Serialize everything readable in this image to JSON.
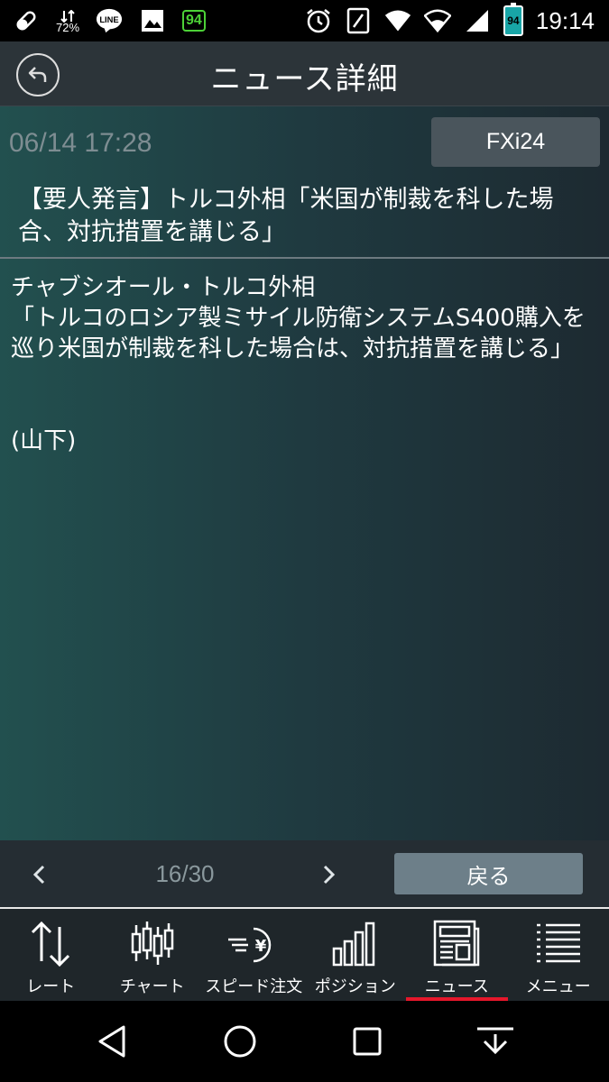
{
  "status_bar": {
    "battery_small": "72%",
    "line_label": "LINE",
    "notif_badge": "94",
    "battery_level": "94",
    "time": "19:14",
    "icons": [
      "pill-icon",
      "data-speed-icon",
      "line-app-icon",
      "gallery-icon",
      "battery-app-icon",
      "alarm-icon",
      "nfc-icon",
      "wifi-call-icon",
      "wifi-icon",
      "signal-icon",
      "battery-icon"
    ]
  },
  "header": {
    "title": "ニュース詳細",
    "back_icon": "reply-arrow-icon"
  },
  "article": {
    "datetime": "06/14 17:28",
    "source": "FXi24",
    "headline": "【要人発言】トルコ外相「米国が制裁を科した場合、対抗措置を講じる」",
    "body": "チャブシオール・トルコ外相\n「トルコのロシア製ミサイル防衛システムS400購入を巡り米国が制裁を科した場合は、対抗措置を講じる」\n\n\n(山下)"
  },
  "pager": {
    "current": "16/30",
    "return_label": "戻る"
  },
  "tabs": [
    {
      "label": "レート",
      "icon": "rate-arrows-icon",
      "active": false
    },
    {
      "label": "チャート",
      "icon": "candlestick-icon",
      "active": false
    },
    {
      "label": "スピード注文",
      "icon": "speed-yen-icon",
      "active": false
    },
    {
      "label": "ポジション",
      "icon": "bar-chart-icon",
      "active": false
    },
    {
      "label": "ニュース",
      "icon": "newspaper-icon",
      "active": true
    },
    {
      "label": "メニュー",
      "icon": "menu-list-icon",
      "active": false
    }
  ],
  "colors": {
    "active_tab_underline": "#e6172b",
    "return_button": "#6d7f89",
    "source_button": "#4a555c"
  }
}
